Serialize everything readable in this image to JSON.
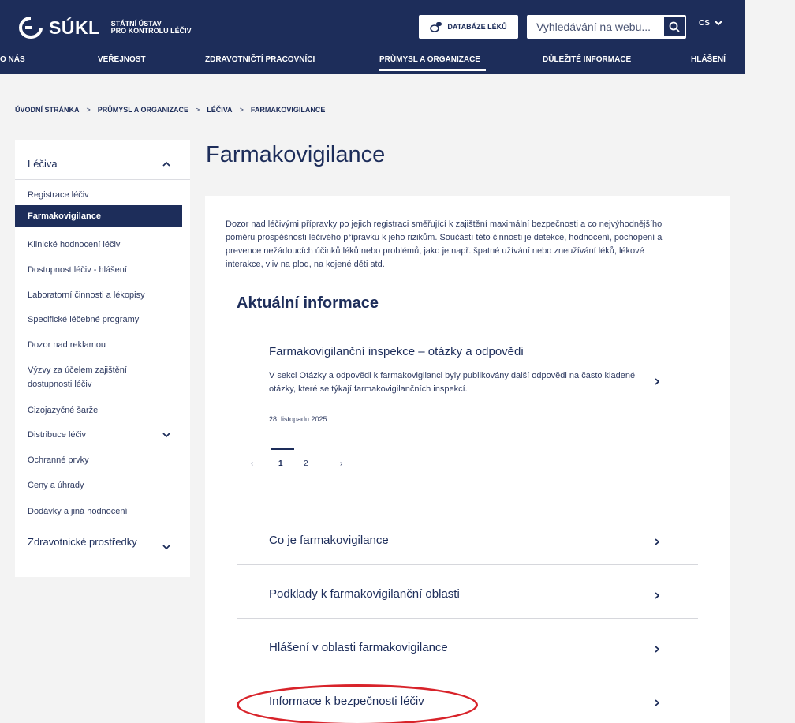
{
  "header": {
    "logo_text": "SÚKL",
    "logo_sub_line1": "STÁTNÍ ÚSTAV",
    "logo_sub_line2": "PRO KONTROLU LÉČIV",
    "database_button": "DATABÁZE LÉKŮ",
    "search_placeholder": "Vyhledávání na webu...",
    "language": "CS"
  },
  "nav": {
    "items": [
      "O NÁS",
      "VEŘEJNOST",
      "ZDRAVOTNIČTÍ PRACOVNÍCI",
      "PRŮMYSL A ORGANIZACE",
      "DŮLEŽITÉ INFORMACE",
      "HLÁŠENÍ"
    ],
    "active": "PRŮMYSL A ORGANIZACE"
  },
  "breadcrumb": [
    "ÚVODNÍ STRÁNKA",
    "PRŮMYSL A ORGANIZACE",
    "LÉČIVA",
    "FARMAKOVIGILANCE"
  ],
  "sidebar": {
    "header": "Léčiva",
    "items": [
      "Registrace léčiv",
      "Farmakovigilance",
      "Klinické hodnocení léčiv",
      "Dostupnost léčiv - hlášení",
      "Laboratorní činnosti a lékopisy",
      "Specifické léčebné programy",
      "Dozor nad reklamou",
      "Výzvy za účelem zajištění dostupnosti léčiv",
      "Cizojazyčné šarže",
      "Distribuce léčiv",
      "Ochranné prvky",
      "Ceny a úhrady",
      "Dodávky a jiná hodnocení"
    ],
    "active": "Farmakovigilance",
    "footer": "Zdravotnické prostředky"
  },
  "main": {
    "title": "Farmakovigilance",
    "intro": "Dozor nad léčivými přípravky po jejich registraci směřující k zajištění maximální bezpečnosti a co nejvýhodnějšího poměru prospěšnosti léčivého přípravku k jeho rizikům. Součástí této činnosti je detekce, hodnocení, pochopení a prevence nežádoucích účinků léků nebo problémů, jako je např. špatné užívání nebo zneužívání léků, lékové interakce, vliv na plod, na kojené děti atd.",
    "section_title": "Aktuální informace",
    "news": {
      "title": "Farmakovigilanční inspekce – otázky a odpovědi",
      "text": "V sekci Otázky a odpovědi k farmakovigilanci byly publikovány další odpovědi na často kladené otázky, které se týkají farmakovigilančních inspekcí.",
      "date": "28. listopadu 2025"
    },
    "pager": {
      "prev": "‹",
      "pages": [
        "1",
        "2"
      ],
      "current": "1",
      "next": "›"
    },
    "links": [
      "Co je farmakovigilance",
      "Podklady k farmakovigilanční oblasti",
      "Hlášení v oblasti farmakovigilance",
      "Informace k bezpečnosti léčiv"
    ]
  }
}
